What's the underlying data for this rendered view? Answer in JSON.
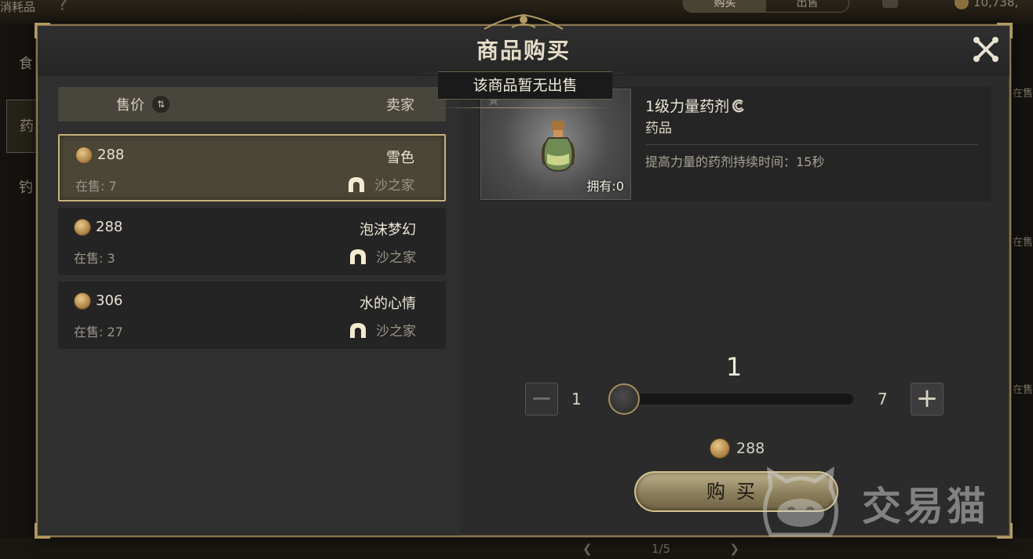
{
  "background": {
    "category_label": "消耗品",
    "help_icon": "question-mark",
    "market_tabs": [
      "购买",
      "出售"
    ],
    "gold_amount": "10,738,",
    "side_items": [
      "食",
      "药",
      "钓"
    ],
    "right_labels": [
      "在售",
      "在售",
      "在售"
    ],
    "pager": "1/5"
  },
  "modal": {
    "title": "商品购买",
    "close_icon": "close-x-icon",
    "tooltip": "该商品暂无出售"
  },
  "list_header": {
    "price_label": "售价",
    "sort_icon": "sort-arrows-icon",
    "seller_label": "卖家"
  },
  "listings": [
    {
      "price": "288",
      "seller": "雪色",
      "stock": "在售: 7",
      "guild": "沙之家",
      "selected": true
    },
    {
      "price": "288",
      "seller": "泡沫梦幻",
      "stock": "在售: 3",
      "guild": "沙之家",
      "selected": false
    },
    {
      "price": "306",
      "seller": "水的心情",
      "stock": "在售: 27",
      "guild": "沙之家",
      "selected": false
    }
  ],
  "item": {
    "name": "1级力量药剂",
    "type": "药品",
    "description": "提高力量的药剂持续时间：15秒",
    "owned": "拥有:0",
    "icon": "potion-bottle-icon"
  },
  "quantity": {
    "value": "1",
    "min": "1",
    "max": "7",
    "fraction": 0.0
  },
  "total": {
    "price": "288"
  },
  "buy_button": {
    "label": "购买"
  },
  "watermark": {
    "text": "交易猫"
  },
  "colors": {
    "gold": "#c8b27a",
    "panel": "#2b2b2b",
    "selected_row": "#4b4636"
  }
}
